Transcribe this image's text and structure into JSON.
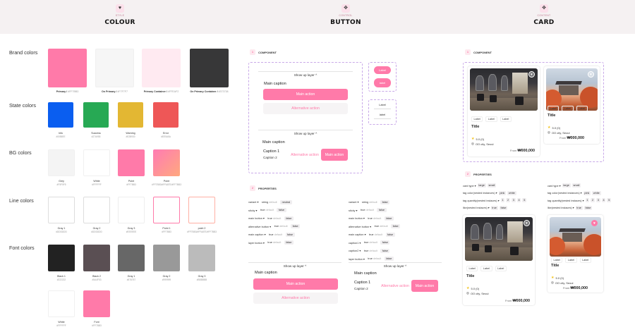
{
  "header": {
    "colour": {
      "icon": "♥",
      "sub": "STYLE",
      "title": "COLOUR"
    },
    "button": {
      "icon": "✥",
      "sub": "CONTROL",
      "title": "BUTTON"
    },
    "card": {
      "icon": "✥",
      "sub": "CONTENT",
      "title": "CARD"
    }
  },
  "colour": {
    "rows": {
      "brand": "Brand colors",
      "state": "State colors",
      "bg": "BG colors",
      "line": "Line colors",
      "font": "Font colors"
    },
    "brand": [
      {
        "name": "Primary",
        "hex": "#FF7BB3",
        "color": "#ff7aa9"
      },
      {
        "name": "On Primary",
        "hex": "#F7F7F7",
        "color": "#f6f6f6"
      },
      {
        "name": "Primary Container",
        "hex": "#FFEAF2",
        "color": "#ffeaf1"
      },
      {
        "name": "On Primary Container",
        "hex": "#373738",
        "color": "#373738"
      }
    ],
    "state": [
      {
        "name": "Info",
        "hex": "#0055EE",
        "color": "#0a5ef0"
      },
      {
        "name": "Success",
        "hex": "#27A955",
        "color": "#27a954"
      },
      {
        "name": "Warning",
        "hex": "#E2B930",
        "color": "#e3b733"
      },
      {
        "name": "Error",
        "hex": "#EE5A5A",
        "color": "#ee5757"
      }
    ],
    "bg": [
      {
        "name": "Grey",
        "hex": "#F5F5F5",
        "color": "#f4f4f4"
      },
      {
        "name": "White",
        "hex": "#FFFFFF",
        "color": "#ffffff"
      },
      {
        "name": "Point",
        "hex": "#FF7BB3",
        "color": "#ff7aa9"
      },
      {
        "name": "Point",
        "hex": "#FF7BB3/#FFA87E/#FF7BB3",
        "color": "#ffa87e"
      }
    ],
    "line": [
      {
        "name": "Gray 1",
        "hex": "#DDDDDD",
        "color": "#dddddd"
      },
      {
        "name": "Gray 2",
        "hex": "#DDDDDD",
        "color": "#dddddd"
      },
      {
        "name": "Gray 3",
        "hex": "#EEEEEE",
        "color": "#eeeeee"
      },
      {
        "name": "Point 1",
        "hex": "#FF7BB3",
        "color": "#ff7aa9"
      },
      {
        "name": "point 2",
        "hex": "#FF7BB3/#FFA87E/#FF7BB3",
        "color": "#ffb8a0"
      }
    ],
    "font": [
      {
        "name": "Black 1",
        "hex": "#222222",
        "color": "#222222"
      },
      {
        "name": "Black 2",
        "hex": "#5A4F53",
        "color": "#5a4f53"
      },
      {
        "name": "Gray 1",
        "hex": "#676767",
        "color": "#676767"
      },
      {
        "name": "Gray 2",
        "hex": "#999999",
        "color": "#999999"
      },
      {
        "name": "Gray 3",
        "hex": "#BBBBBB",
        "color": "#bbbbbb"
      },
      {
        "name": "White",
        "hex": "#FFFFFF",
        "color": "#ffffff"
      },
      {
        "name": "Font",
        "hex": "#FF7BB3",
        "color": "#ff7aa9"
      }
    ]
  },
  "button": {
    "component": {
      "num": "1",
      "title": "COMPONENT"
    },
    "properties": {
      "num": "2",
      "title": "PROPERTIES"
    },
    "show_up": "Show up layer",
    "chevron": "^",
    "main_caption": "Main caption",
    "main_action": "Main action",
    "alt_action": "Alternative action",
    "caption1": "Caption 1",
    "caption2": "Caption 2",
    "label": "Label",
    "label_lower": "label",
    "props_left": [
      {
        "name": "variant",
        "vals": [
          [
            "string",
            "default"
          ],
          [
            "neutral",
            ""
          ]
        ]
      },
      {
        "name": "sticky",
        "vals": [
          [
            "true",
            "default"
          ],
          [
            "false",
            ""
          ]
        ]
      },
      {
        "name": "main button",
        "vals": [
          [
            "true",
            "default"
          ],
          [
            "false",
            ""
          ]
        ]
      },
      {
        "name": "alternative button",
        "vals": [
          [
            "true",
            "default"
          ],
          [
            "false",
            ""
          ]
        ]
      },
      {
        "name": "main caption",
        "vals": [
          [
            "true",
            "default"
          ],
          [
            "false",
            ""
          ]
        ]
      },
      {
        "name": "layer button",
        "vals": [
          [
            "true",
            "default"
          ],
          [
            "false",
            ""
          ]
        ]
      }
    ],
    "props_right": [
      {
        "name": "variant",
        "vals": [
          [
            "string",
            "default"
          ],
          [
            "false",
            ""
          ]
        ]
      },
      {
        "name": "sticky",
        "vals": [
          [
            "true",
            "default"
          ],
          [
            "false",
            ""
          ]
        ]
      },
      {
        "name": "main button",
        "vals": [
          [
            "true",
            "default"
          ],
          [
            "false",
            ""
          ]
        ]
      },
      {
        "name": "alternative button",
        "vals": [
          [
            "true",
            "default"
          ],
          [
            "false",
            ""
          ]
        ]
      },
      {
        "name": "main caption",
        "vals": [
          [
            "true",
            "default"
          ],
          [
            "false",
            ""
          ]
        ]
      },
      {
        "name": "caption1",
        "vals": [
          [
            "true",
            "default"
          ],
          [
            "false",
            ""
          ]
        ]
      },
      {
        "name": "caption2",
        "vals": [
          [
            "true",
            "default"
          ],
          [
            "false",
            ""
          ]
        ]
      },
      {
        "name": "layer button",
        "vals": [
          [
            "true",
            "default"
          ],
          [
            "false",
            ""
          ]
        ]
      }
    ]
  },
  "card": {
    "component": {
      "num": "1",
      "title": "COMPONENT"
    },
    "properties": {
      "num": "2",
      "title": "PROPERTIES"
    },
    "label": "Label",
    "title": "Title",
    "rating": "5.0 (0)",
    "location": "OO city, Seoul",
    "price_prefix": "From",
    "price": "₩000,000",
    "heart": "♥",
    "props_left": [
      {
        "name": "card type",
        "vals": [
          "large",
          "small"
        ]
      },
      {
        "name": "tag color(nested instances)",
        "vals": [
          "pink",
          "white"
        ]
      },
      {
        "name": "tag quantity(nested instaces)",
        "vals": [
          "1",
          "2",
          "3",
          "4",
          "5"
        ]
      },
      {
        "name": "like(nested instaces)",
        "vals": [
          "true",
          "false"
        ]
      }
    ],
    "props_right": [
      {
        "name": "card type",
        "vals": [
          "large",
          "small"
        ]
      },
      {
        "name": "tag color(nested instances)",
        "vals": [
          "pink",
          "white"
        ]
      },
      {
        "name": "tag quantity(nested instaces)",
        "vals": [
          "1",
          "2",
          "3",
          "4",
          "5"
        ]
      },
      {
        "name": "like(nested instaces)",
        "vals": [
          "true",
          "false"
        ]
      }
    ]
  }
}
